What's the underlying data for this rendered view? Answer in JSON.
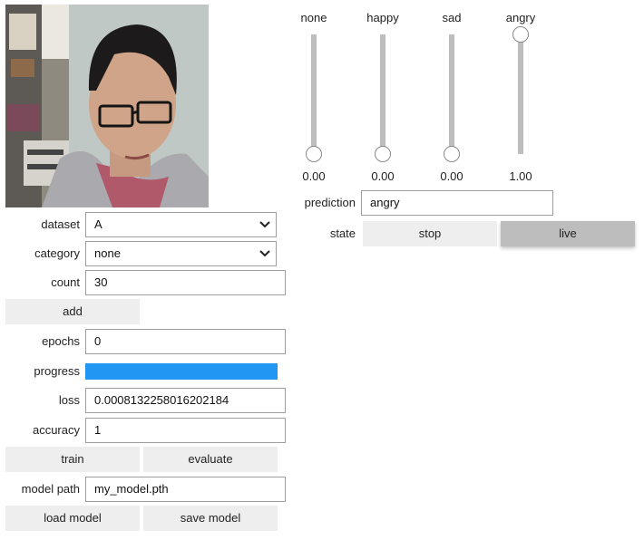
{
  "camera": {
    "alt": "webcam frame"
  },
  "form": {
    "dataset": {
      "label": "dataset",
      "value": "A"
    },
    "category": {
      "label": "category",
      "value": "none"
    },
    "count": {
      "label": "count",
      "value": "30"
    },
    "add_button": "add",
    "epochs": {
      "label": "epochs",
      "value": "0"
    },
    "progress": {
      "label": "progress",
      "value": 1.0,
      "color": "#2196f3"
    },
    "loss": {
      "label": "loss",
      "value": "0.0008132258016202184"
    },
    "accuracy": {
      "label": "accuracy",
      "value": "1"
    },
    "train_button": "train",
    "evaluate_button": "evaluate",
    "model_path": {
      "label": "model path",
      "value": "my_model.pth"
    },
    "load_button": "load model",
    "save_button": "save model"
  },
  "sliders": [
    {
      "name": "none",
      "value": "0.00",
      "level": 0.0
    },
    {
      "name": "happy",
      "value": "0.00",
      "level": 0.0
    },
    {
      "name": "sad",
      "value": "0.00",
      "level": 0.0
    },
    {
      "name": "angry",
      "value": "1.00",
      "level": 1.0
    }
  ],
  "prediction": {
    "label": "prediction",
    "value": "angry"
  },
  "state": {
    "label": "state",
    "options": [
      "stop",
      "live"
    ],
    "selected": "live"
  }
}
